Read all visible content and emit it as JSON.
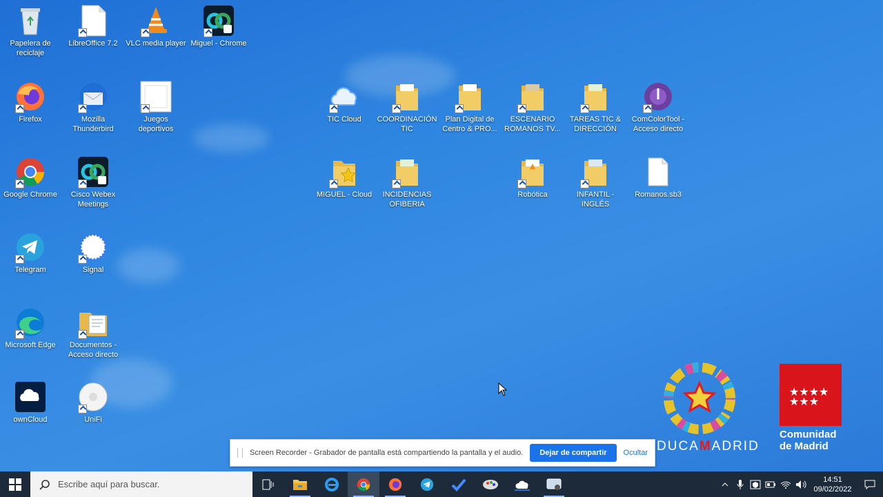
{
  "desktop_icons": [
    {
      "label": "Papelera de reciclaje",
      "icon": "recycle-bin-icon"
    },
    {
      "label": "LibreOffice 7.2",
      "icon": "libreoffice-icon"
    },
    {
      "label": "VLC media player",
      "icon": "vlc-icon"
    },
    {
      "label": "Miguel - Chrome",
      "icon": "webex-chrome-icon"
    },
    {
      "label": "Firefox",
      "icon": "firefox-icon"
    },
    {
      "label": "Mozilla Thunderbird",
      "icon": "thunderbird-icon"
    },
    {
      "label": "Juegos deportivos",
      "icon": "document-icon"
    },
    {
      "label": "Google Chrome",
      "icon": "chrome-icon"
    },
    {
      "label": "Cisco Webex Meetings",
      "icon": "webex-icon"
    },
    {
      "label": "Telegram",
      "icon": "telegram-icon"
    },
    {
      "label": "Signal",
      "icon": "signal-icon"
    },
    {
      "label": "Microsoft Edge",
      "icon": "edge-icon"
    },
    {
      "label": "Documentos - Acceso directo",
      "icon": "folder-docs-icon"
    },
    {
      "label": "ownCloud",
      "icon": "owncloud-icon"
    },
    {
      "label": "UniFi",
      "icon": "unifi-icon"
    },
    {
      "label": "TIC Cloud",
      "icon": "cloud-icon"
    },
    {
      "label": "COORDINACIÓN TIC",
      "icon": "folder-icon"
    },
    {
      "label": "Plan Digital de Centro & PRO...",
      "icon": "folder-icon"
    },
    {
      "label": "ESCENARIO ROMANOS TV...",
      "icon": "folder-icon"
    },
    {
      "label": "TAREAS TIC & DIRECCIÓN",
      "icon": "folder-icon"
    },
    {
      "label": "ComColorTool - Acceso directo",
      "icon": "comcolortool-icon"
    },
    {
      "label": "MIGUEL - Cloud",
      "icon": "folder-star-icon"
    },
    {
      "label": "INCIDENCIAS OFIBERIA",
      "icon": "folder-icon"
    },
    {
      "label": "Robótica",
      "icon": "folder-icon"
    },
    {
      "label": "INFANTIL - INGLÉS",
      "icon": "folder-icon"
    },
    {
      "label": "Romanos.sb3",
      "icon": "file-icon"
    }
  ],
  "share_bar": {
    "message": "Screen Recorder - Grabador de pantalla está compartiendo la pantalla y el audio.",
    "stop_label": "Dejar de compartir",
    "hide_label": "Ocultar"
  },
  "logos": {
    "educa": "DUCA",
    "educa_m": "M",
    "educa_rest": "ADRID",
    "cam_line1": "Comunidad",
    "cam_line2": "de Madrid"
  },
  "taskbar": {
    "search_placeholder": "Escribe aquí para buscar.",
    "time": "14:51",
    "date": "09/02/2022"
  },
  "colors": {
    "desktop": "#2f86e0",
    "taskbar": "#1c2a3a",
    "accent": "#1a73e8",
    "madrid_red": "#d9151b"
  }
}
